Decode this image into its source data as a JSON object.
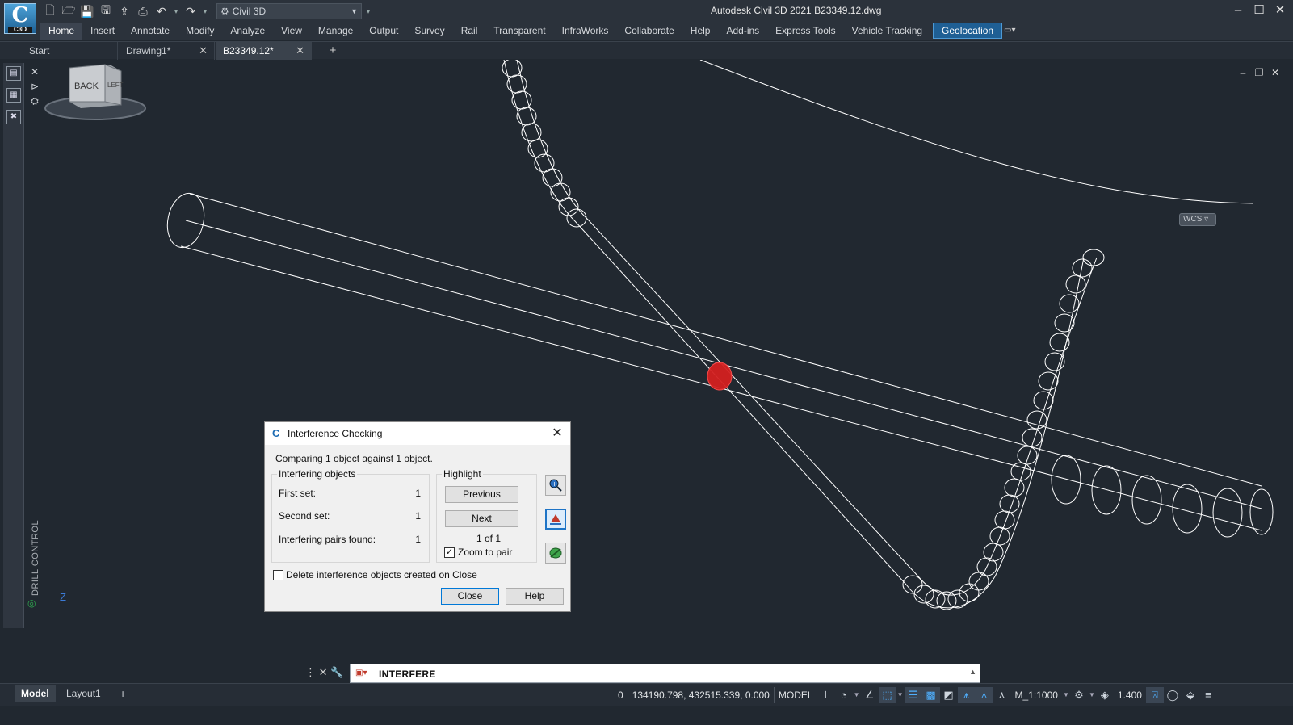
{
  "app": {
    "logo_text": "C",
    "logo_sub": "C3D",
    "window_title": "Autodesk Civil 3D 2021    B23349.12.dwg",
    "workspace": "Civil 3D"
  },
  "qat": {
    "icons": [
      "new-icon",
      "open-icon",
      "save-icon",
      "save-as-icon",
      "import-icon",
      "plot-icon",
      "undo-icon",
      "redo-icon"
    ]
  },
  "ribbon": {
    "tabs": [
      {
        "label": "Home",
        "state": "active"
      },
      {
        "label": "Insert",
        "state": ""
      },
      {
        "label": "Annotate",
        "state": ""
      },
      {
        "label": "Modify",
        "state": ""
      },
      {
        "label": "Analyze",
        "state": ""
      },
      {
        "label": "View",
        "state": ""
      },
      {
        "label": "Manage",
        "state": ""
      },
      {
        "label": "Output",
        "state": ""
      },
      {
        "label": "Survey",
        "state": ""
      },
      {
        "label": "Rail",
        "state": ""
      },
      {
        "label": "Transparent",
        "state": ""
      },
      {
        "label": "InfraWorks",
        "state": ""
      },
      {
        "label": "Collaborate",
        "state": ""
      },
      {
        "label": "Help",
        "state": ""
      },
      {
        "label": "Add-ins",
        "state": ""
      },
      {
        "label": "Express Tools",
        "state": ""
      },
      {
        "label": "Vehicle Tracking",
        "state": ""
      },
      {
        "label": "Geolocation",
        "state": "highlight"
      }
    ]
  },
  "file_tabs": [
    {
      "label": "Start",
      "closable": false,
      "active": false
    },
    {
      "label": "Drawing1*",
      "closable": true,
      "active": false
    },
    {
      "label": "B23349.12*",
      "closable": true,
      "active": true
    }
  ],
  "palette": {
    "label": "DRILL CONTROL"
  },
  "viewcube": {
    "face_back": "BACK",
    "face_left": "LEFT",
    "wcs": "WCS"
  },
  "ucs": {
    "z_label": "Z"
  },
  "dialog": {
    "title": "Interference Checking",
    "summary": "Comparing 1 object against 1 object.",
    "interfering_group": "Interfering objects",
    "rows": [
      {
        "label": "First set:",
        "value": "1"
      },
      {
        "label": "Second set:",
        "value": "1"
      },
      {
        "label": "Interfering pairs found:",
        "value": "1"
      }
    ],
    "highlight_group": "Highlight",
    "previous": "Previous",
    "next": "Next",
    "counter": "1 of 1",
    "zoom_to_pair": "Zoom to pair",
    "zoom_checked": true,
    "delete_label": "Delete interference objects created on Close",
    "delete_checked": false,
    "close": "Close",
    "help": "Help"
  },
  "command": {
    "text": "INTERFERE"
  },
  "status": {
    "layout_tabs": [
      {
        "label": "Model",
        "active": true
      },
      {
        "label": "Layout1",
        "active": false
      }
    ],
    "count": "0",
    "coords": "134190.798, 432515.339, 0.000",
    "space": "MODEL",
    "scale": "M_1:1000",
    "lineweight": "1.400"
  },
  "colors": {
    "background": "#212830",
    "wire": "#ffffff",
    "clash": "#d42020",
    "accent": "#1f5f94"
  }
}
